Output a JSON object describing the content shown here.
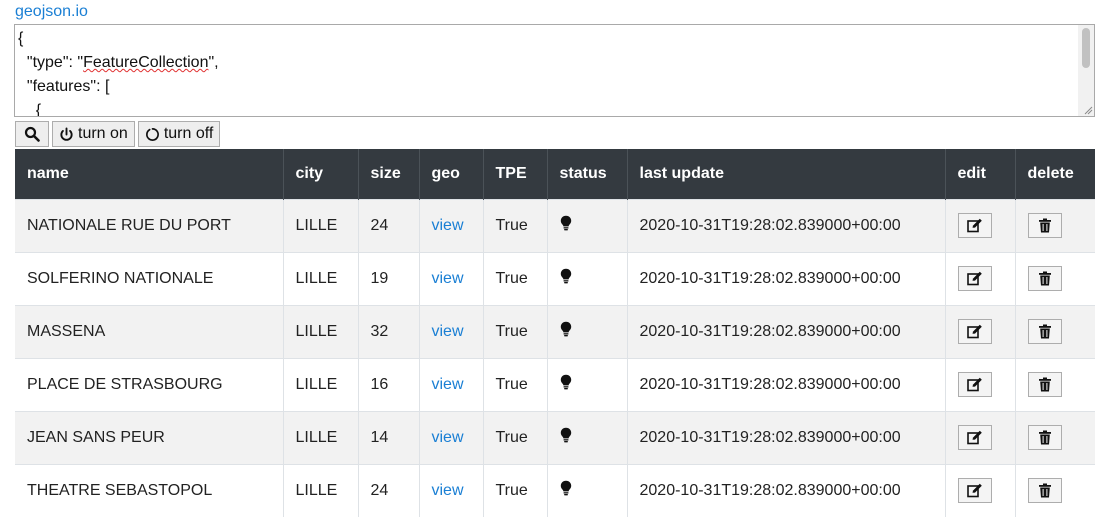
{
  "header": {
    "link_label": "geojson.io"
  },
  "editor": {
    "lines": [
      "{",
      "  \"type\": \"",
      "FeatureCollection",
      "\",",
      "  \"features\": [",
      "    {"
    ]
  },
  "toolbar": {
    "turn_on_label": "turn on",
    "turn_off_label": "turn off"
  },
  "table": {
    "columns": [
      "name",
      "city",
      "size",
      "geo",
      "TPE",
      "status",
      "last update",
      "edit",
      "delete"
    ],
    "rows": [
      {
        "name": "NATIONALE RUE DU PORT",
        "city": "LILLE",
        "size": "24",
        "geo": "view",
        "tpe": "True",
        "status_icon": "lightbulb-icon",
        "last_update": "2020-10-31T19:28:02.839000+00:00"
      },
      {
        "name": "SOLFERINO NATIONALE",
        "city": "LILLE",
        "size": "19",
        "geo": "view",
        "tpe": "True",
        "status_icon": "lightbulb-icon",
        "last_update": "2020-10-31T19:28:02.839000+00:00"
      },
      {
        "name": "MASSENA",
        "city": "LILLE",
        "size": "32",
        "geo": "view",
        "tpe": "True",
        "status_icon": "lightbulb-icon",
        "last_update": "2020-10-31T19:28:02.839000+00:00"
      },
      {
        "name": "PLACE DE STRASBOURG",
        "city": "LILLE",
        "size": "16",
        "geo": "view",
        "tpe": "True",
        "status_icon": "lightbulb-icon",
        "last_update": "2020-10-31T19:28:02.839000+00:00"
      },
      {
        "name": "JEAN SANS PEUR",
        "city": "LILLE",
        "size": "14",
        "geo": "view",
        "tpe": "True",
        "status_icon": "lightbulb-icon",
        "last_update": "2020-10-31T19:28:02.839000+00:00"
      },
      {
        "name": "THEATRE SEBASTOPOL",
        "city": "LILLE",
        "size": "24",
        "geo": "view",
        "tpe": "True",
        "status_icon": "lightbulb-icon",
        "last_update": "2020-10-31T19:28:02.839000+00:00"
      }
    ]
  },
  "colors": {
    "header_bg": "#343a40",
    "link": "#1a7fd4",
    "row_stripe": "#f2f2f2"
  }
}
